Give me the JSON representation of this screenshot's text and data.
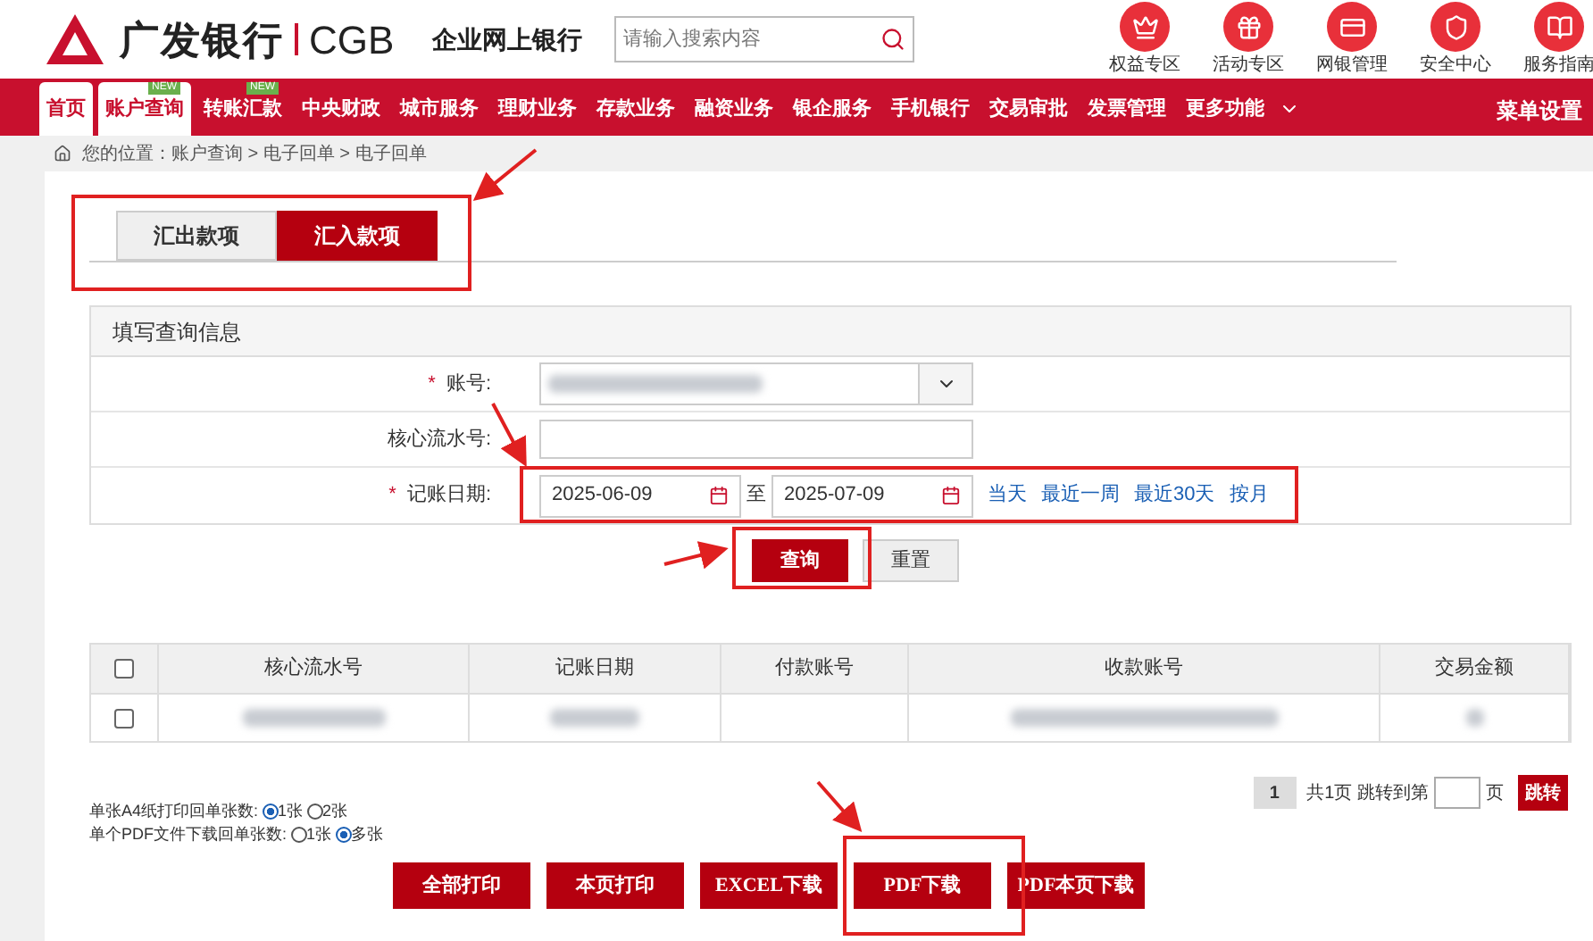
{
  "header": {
    "logo_text": "广发银行",
    "logo_en": "CGB",
    "product": "企业网上银行",
    "search": {
      "placeholder": "请输入搜索内容"
    },
    "shortcuts": [
      {
        "label": "权益专区",
        "kind": "crown"
      },
      {
        "label": "活动专区",
        "kind": "gift"
      },
      {
        "label": "网银管理",
        "kind": "card"
      },
      {
        "label": "安全中心",
        "kind": "shield"
      },
      {
        "label": "服务指南",
        "kind": "book"
      }
    ]
  },
  "nav": {
    "items": [
      {
        "label": "首页",
        "selected": true
      },
      {
        "label": "账户查询",
        "selected": true,
        "badge": "NEW"
      },
      {
        "label": "转账汇款",
        "selected": false,
        "badge": "NEW"
      },
      {
        "label": "中央财政",
        "selected": false
      },
      {
        "label": "城市服务",
        "selected": false
      },
      {
        "label": "理财业务",
        "selected": false
      },
      {
        "label": "存款业务",
        "selected": false
      },
      {
        "label": "融资业务",
        "selected": false
      },
      {
        "label": "银企服务",
        "selected": false
      },
      {
        "label": "手机银行",
        "selected": false
      },
      {
        "label": "交易审批",
        "selected": false
      },
      {
        "label": "发票管理",
        "selected": false
      },
      {
        "label": "更多功能",
        "selected": false,
        "dropdown": true
      }
    ],
    "settings": "菜单设置"
  },
  "breadcrumb": "您的位置：账户查询 > 电子回单 > 电子回单",
  "tabs": [
    {
      "label": "汇出款项",
      "selected": false
    },
    {
      "label": "汇入款项",
      "selected": true
    }
  ],
  "query_panel": {
    "title": "填写查询信息",
    "account": {
      "label": "账号:",
      "required_mark": "*"
    },
    "serial": {
      "label": "核心流水号:"
    },
    "date": {
      "label": "记账日期:",
      "required_mark": "*",
      "from": "2025-06-09",
      "separator": "至",
      "to": "2025-07-09",
      "quick_links": [
        "当天",
        "最近一周",
        "最近30天",
        "按月"
      ]
    },
    "buttons": [
      {
        "label": "查询",
        "kind": "primary"
      },
      {
        "label": "重置",
        "kind": "secondary"
      }
    ]
  },
  "table": {
    "columns": [
      "核心流水号",
      "记账日期",
      "付款账号",
      "收款账号",
      "交易金额"
    ],
    "header_checked": false,
    "rows": [
      {
        "checked": false
      }
    ]
  },
  "pagination": {
    "current": "1",
    "summary": "共1页 跳转到第",
    "unit": "页",
    "go": "跳转"
  },
  "options": [
    {
      "label": "单张A4纸打印回单张数:",
      "choices": [
        {
          "label": "1张",
          "selected": true
        },
        {
          "label": "2张",
          "selected": false
        }
      ]
    },
    {
      "label": "单个PDF文件下载回单张数:",
      "choices": [
        {
          "label": "1张",
          "selected": false
        },
        {
          "label": "多张",
          "selected": true
        }
      ]
    }
  ],
  "actions": [
    "全部打印",
    "本页打印",
    "EXCEL下载",
    "PDF下载",
    "PDF本页下载"
  ]
}
